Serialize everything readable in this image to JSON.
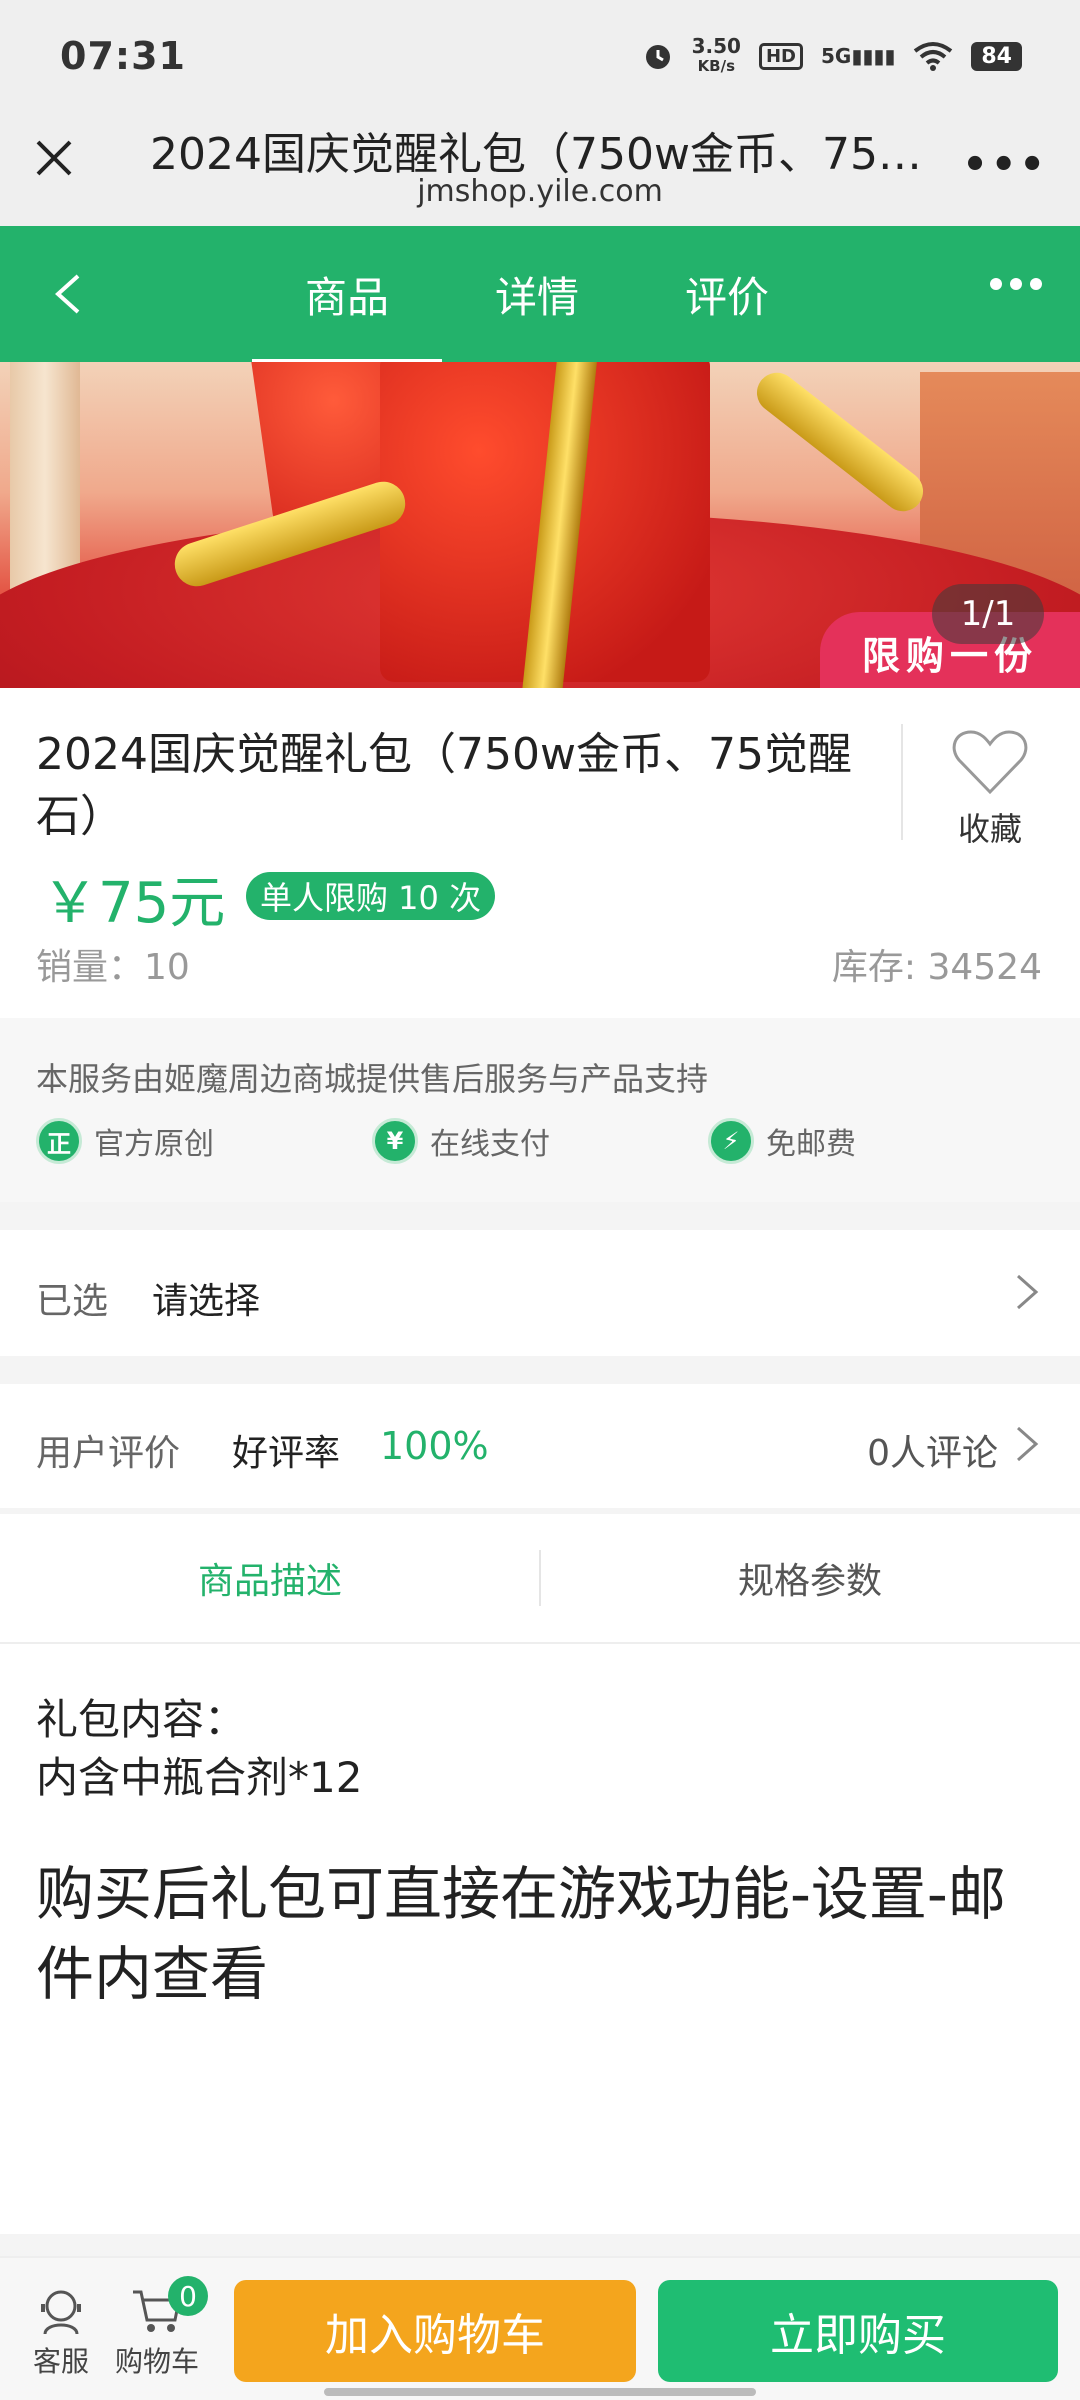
{
  "status_bar": {
    "time": "07:31",
    "speed_value": "3.50",
    "speed_unit": "KB/s",
    "hd": "HD",
    "network": "5G",
    "battery": "84"
  },
  "browser": {
    "title": "2024国庆觉醒礼包（750w金币、75…",
    "url": "jmshop.yile.com"
  },
  "nav": {
    "tabs": [
      "商品",
      "详情",
      "评价"
    ]
  },
  "banner": {
    "counter": "1/1",
    "tag": "限购一份"
  },
  "product": {
    "title": "2024国庆觉醒礼包（750w金币、75觉醒石）",
    "favorite_label": "收藏",
    "price": "￥75元",
    "limit_badge": "单人限购 10 次",
    "sales": "销量：10",
    "stock": "库存: 34524"
  },
  "service": {
    "text": "本服务由姬魔周边商城提供售后服务与产品支持",
    "items": [
      {
        "icon": "正",
        "label": "官方原创"
      },
      {
        "icon": "¥",
        "label": "在线支付"
      },
      {
        "icon": "⚡",
        "label": "免邮费"
      }
    ]
  },
  "selection": {
    "label": "已选",
    "value": "请选择"
  },
  "review": {
    "label": "用户评价",
    "rate_label": "好评率",
    "rate_value": "100%",
    "count": "0人评论"
  },
  "desc_tabs": {
    "description": "商品描述",
    "specs": "规格参数"
  },
  "description": {
    "line1": "礼包内容：",
    "line2": "内含中瓶合剂*12",
    "big_text": "购买后礼包可直接在游戏功能-设置-邮件内查看"
  },
  "bottom": {
    "service_label": "客服",
    "cart_label": "购物车",
    "cart_count": "0",
    "add_cart": "加入购物车",
    "buy_now": "立即购买"
  },
  "colors": {
    "brand_green": "#23b26b",
    "orange": "#f4a51d",
    "buy_green": "#1fbd72"
  }
}
